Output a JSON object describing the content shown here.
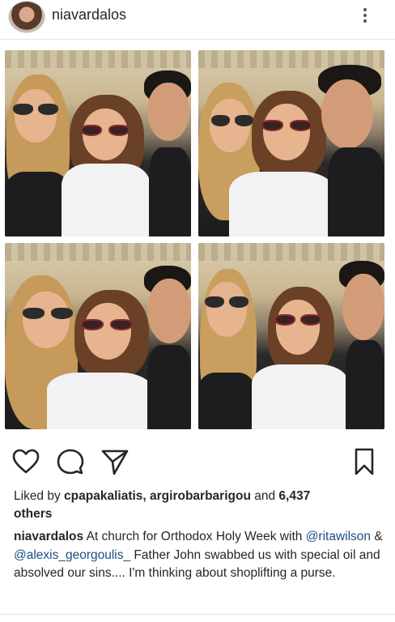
{
  "post": {
    "username": "niavardalos",
    "likes": {
      "prefix": "Liked by ",
      "user1": "cpapakaliatis",
      "comma": ", ",
      "user2": "argirobarbarigou",
      "and": " and ",
      "count": "6,437",
      "suffix": "others"
    },
    "caption": {
      "username": "niavardalos",
      "text1": " At church for Orthodox Holy Week with ",
      "mention1": "@ritawilson",
      "text2": " & ",
      "mention2": "@alexis_georgoulis_",
      "text3": " Father John swabbed us with special oil and absolved our sins.... I'm thinking about shoplifting a purse."
    }
  },
  "icons": {
    "more": "more-options-icon",
    "like": "heart-icon",
    "comment": "comment-icon",
    "share": "send-icon",
    "save": "bookmark-icon"
  }
}
